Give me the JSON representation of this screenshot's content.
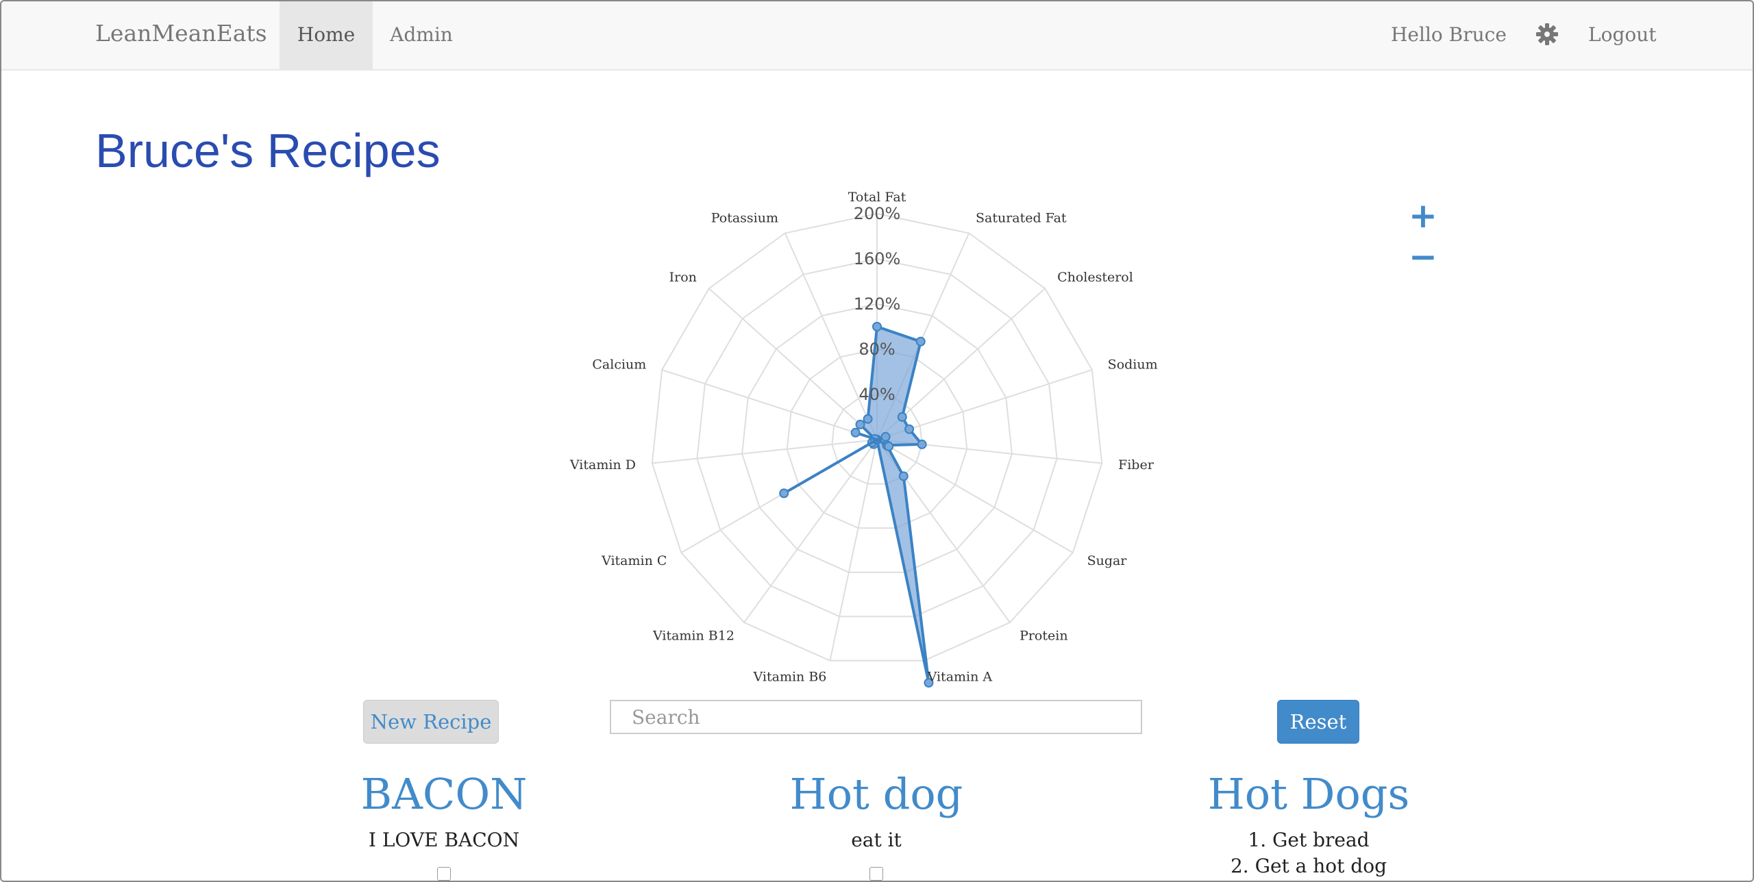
{
  "navbar": {
    "brand": "LeanMeanEats",
    "items": [
      {
        "label": "Home"
      },
      {
        "label": "Admin"
      }
    ],
    "greeting": "Hello Bruce",
    "settings_icon": "gear-icon",
    "logout": "Logout"
  },
  "page": {
    "title": "Bruce's Recipes"
  },
  "zoom": {
    "in": "+",
    "out": "−"
  },
  "chart_data": {
    "type": "radar",
    "axes": [
      "Total Fat",
      "Saturated Fat",
      "Cholesterol",
      "Sodium",
      "Fiber",
      "Sugar",
      "Protein",
      "Vitamin A",
      "Vitamin B6",
      "Vitamin B12",
      "Vitamin C",
      "Vitamin D",
      "Calcium",
      "Iron",
      "Potassium"
    ],
    "tick_labels": [
      "40%",
      "80%",
      "120%",
      "160%",
      "200%"
    ],
    "rmax": 200,
    "values": [
      100,
      95,
      30,
      30,
      40,
      10,
      40,
      220,
      0,
      5,
      5,
      0,
      2,
      20,
      20
    ],
    "secondary_series_points": [
      {
        "axis": "Vitamin C",
        "value": 95
      },
      {
        "axis": "Calcium",
        "value": 20
      },
      {
        "axis": "Sodium",
        "value": 8
      },
      {
        "axis": "Sugar",
        "value": 12
      }
    ],
    "fill_color": "#7aa7d9",
    "stroke_color": "#3b82c4",
    "grid": true
  },
  "controls": {
    "new_recipe": "New Recipe",
    "search_placeholder": "Search",
    "reset": "Reset"
  },
  "recipes": [
    {
      "title": "BACON",
      "description": "I LOVE BACON"
    },
    {
      "title": "Hot dog",
      "description": "eat it"
    },
    {
      "title": "Hot Dogs",
      "steps": [
        "1. Get bread",
        "2. Get a hot dog"
      ]
    }
  ],
  "colors": {
    "accent": "#428bca",
    "title": "#2a4cb0"
  }
}
